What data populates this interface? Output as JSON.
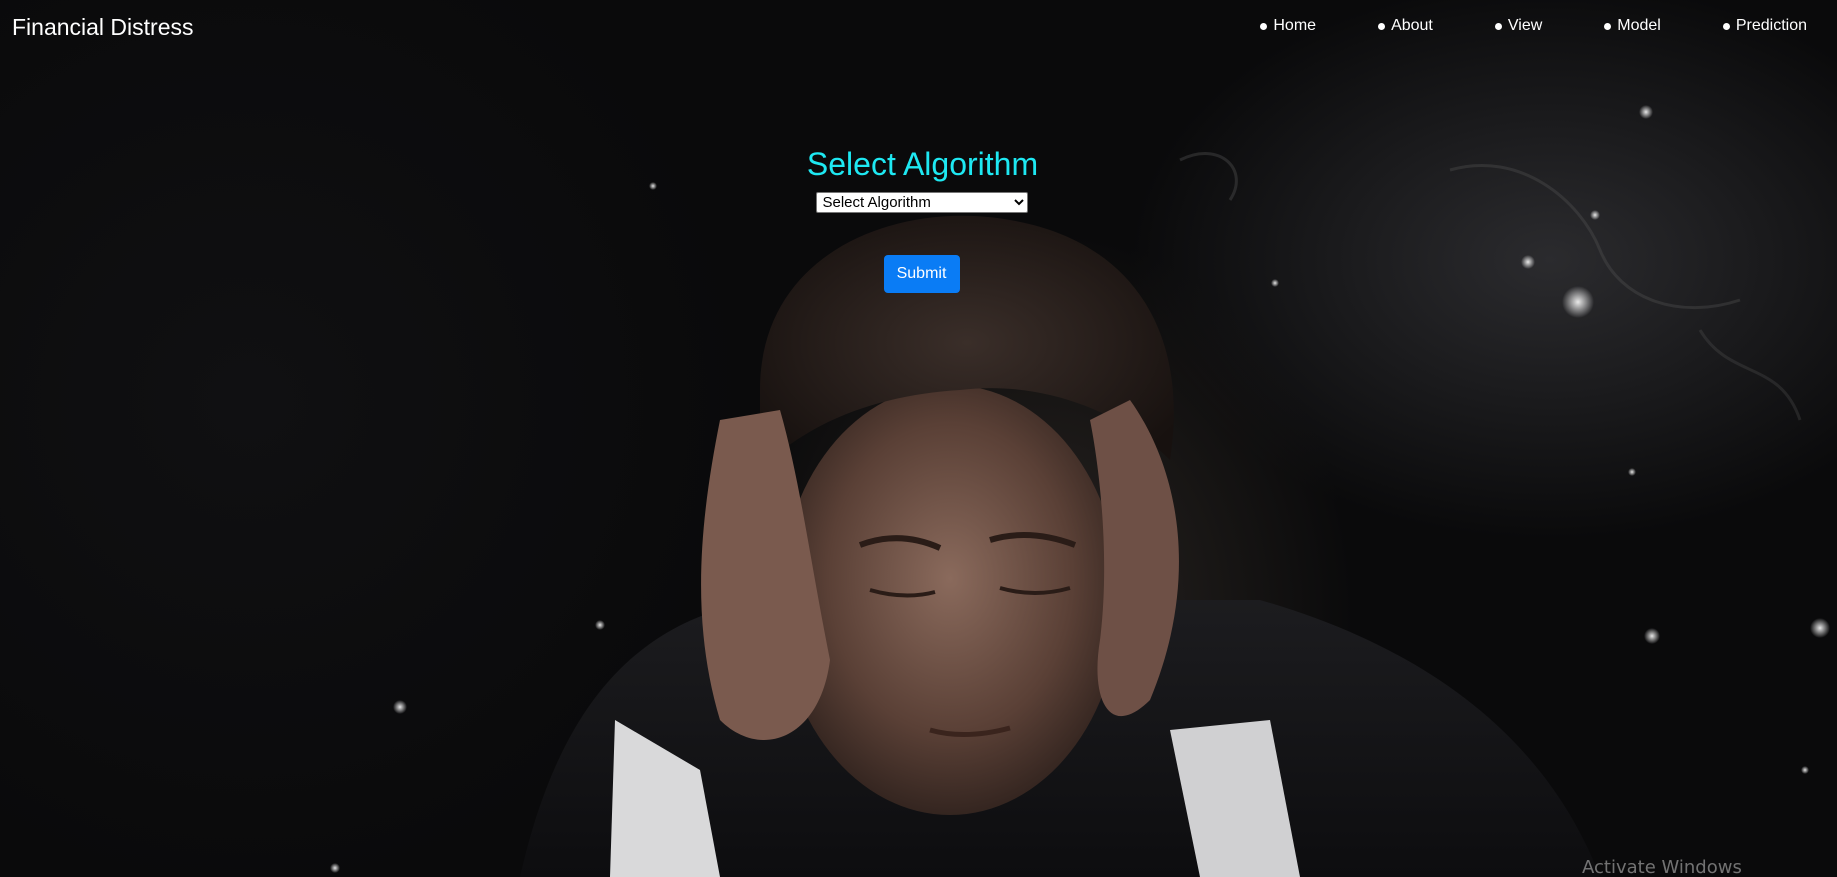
{
  "header": {
    "brand": "Financial Distress",
    "nav": [
      {
        "label": "Home"
      },
      {
        "label": "About"
      },
      {
        "label": "View"
      },
      {
        "label": "Model"
      },
      {
        "label": "Prediction"
      }
    ]
  },
  "form": {
    "title": "Select Algorithm",
    "select": {
      "selected": "Select Algorithm",
      "options": [
        "Select Algorithm"
      ]
    },
    "submit_label": "Submit"
  },
  "system": {
    "watermark": "Activate Windows"
  },
  "colors": {
    "title": "#1ee8f2",
    "submit": "#0a7cf5",
    "background": "#0a0a0b"
  }
}
